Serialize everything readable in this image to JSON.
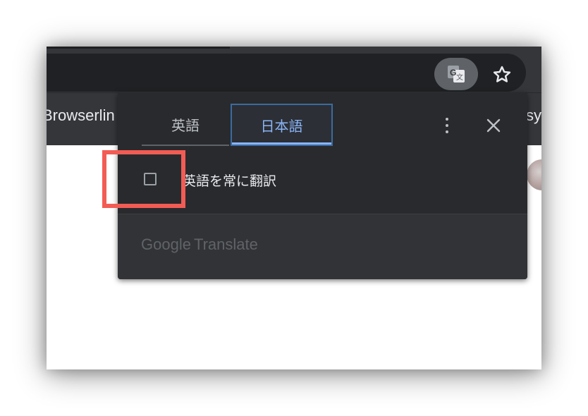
{
  "bookmarks_bar": {
    "left_item": "Browserlin",
    "right_item": "sy"
  },
  "toolbar": {
    "translate_icon": "google-translate-icon",
    "star_icon": "bookmark-star-icon"
  },
  "translate_bubble": {
    "tabs": [
      {
        "label": "英語",
        "selected": false
      },
      {
        "label": "日本語",
        "selected": true
      }
    ],
    "menu_icon": "more-vert-icon",
    "close_icon": "close-icon",
    "always_translate": {
      "label": "英語を常に翻訳",
      "checked": false
    },
    "footer": {
      "brand": "Google",
      "product": "Translate"
    }
  },
  "colors": {
    "highlight": "#f25c54",
    "accent": "#8ab4f8",
    "bubble_bg": "#292a2d",
    "toolbar_bg": "#35363a"
  }
}
